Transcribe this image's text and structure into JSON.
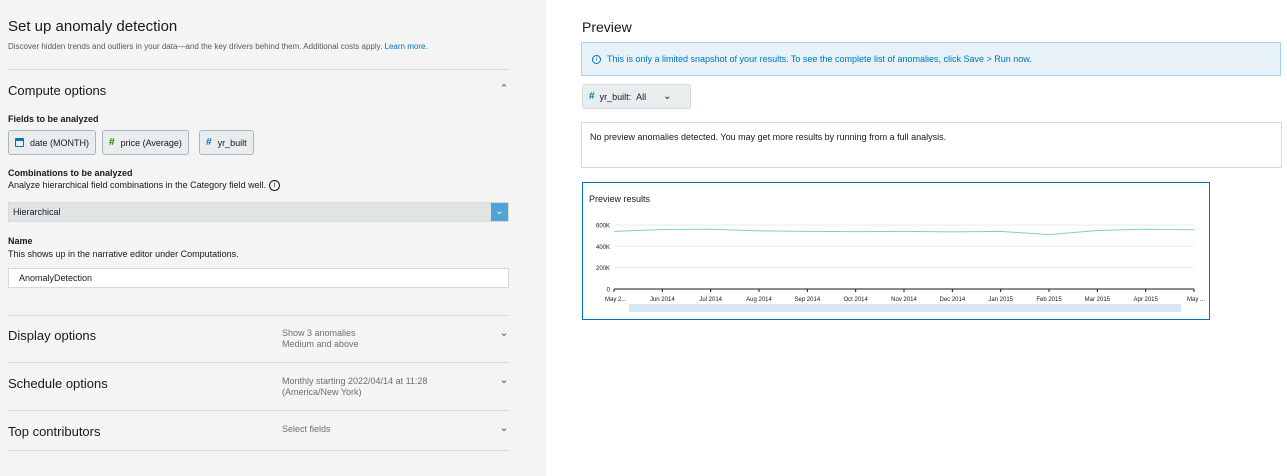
{
  "left": {
    "title": "Set up anomaly detection",
    "description": "Discover hidden trends and outliers in your data—and the key drivers behind them. Additional costs apply.",
    "learn_more": "Learn more.",
    "compute": {
      "heading": "Compute options",
      "fields_label": "Fields to be analyzed",
      "fields": [
        {
          "label": "date (MONTH)",
          "icon": "calendar-icon"
        },
        {
          "label": "price (Average)",
          "icon": "hash-icon"
        },
        {
          "label": "yr_built",
          "icon": "hash-icon"
        }
      ],
      "combinations_label": "Combinations to be analyzed",
      "combinations_desc": "Analyze hierarchical field combinations in the Category field well.",
      "combinations_value": "Hierarchical",
      "name_label": "Name",
      "name_desc": "This shows up in the narrative editor under Computations.",
      "name_value": "AnomalyDetection"
    },
    "display": {
      "heading": "Display options",
      "summary_line1": "Show 3 anomalies",
      "summary_line2": "Medium and above"
    },
    "schedule": {
      "heading": "Schedule options",
      "summary_line1": "Monthly starting 2022/04/14 at 11:28",
      "summary_line2": "(America/New York)"
    },
    "contributors": {
      "heading": "Top contributors",
      "summary_line1": "Select fields"
    }
  },
  "right": {
    "title": "Preview",
    "banner": "This is only a limited snapshot of your results. To see the complete list of anomalies, click Save > Run now.",
    "filter": {
      "label": "yr_built:",
      "value": "All"
    },
    "message": "No preview anomalies detected. You may get more results by running from a full analysis.",
    "chart_title": "Preview results"
  },
  "chart_data": {
    "type": "line",
    "title": "Preview results",
    "categories": [
      "May 2...",
      "Jun 2014",
      "Jul 2014",
      "Aug 2014",
      "Sep 2014",
      "Oct 2014",
      "Nov 2014",
      "Dec 2014",
      "Jan 2015",
      "Feb 2015",
      "Mar 2015",
      "Apr 2015",
      "May ..."
    ],
    "y_ticks": [
      "0",
      "200K",
      "400K",
      "600K"
    ],
    "ylim": [
      0,
      600000
    ],
    "values": [
      540000,
      558000,
      560000,
      545000,
      540000,
      538000,
      540000,
      535000,
      540000,
      510000,
      548000,
      560000,
      555000
    ],
    "colors": {
      "line": "#7fd0c9",
      "scroll_bar": "#d7e7f3"
    }
  },
  "colors": {
    "accent": "#0073bb",
    "banner_bg": "#e6f2f8",
    "select_caret": "#4fa3d7"
  }
}
